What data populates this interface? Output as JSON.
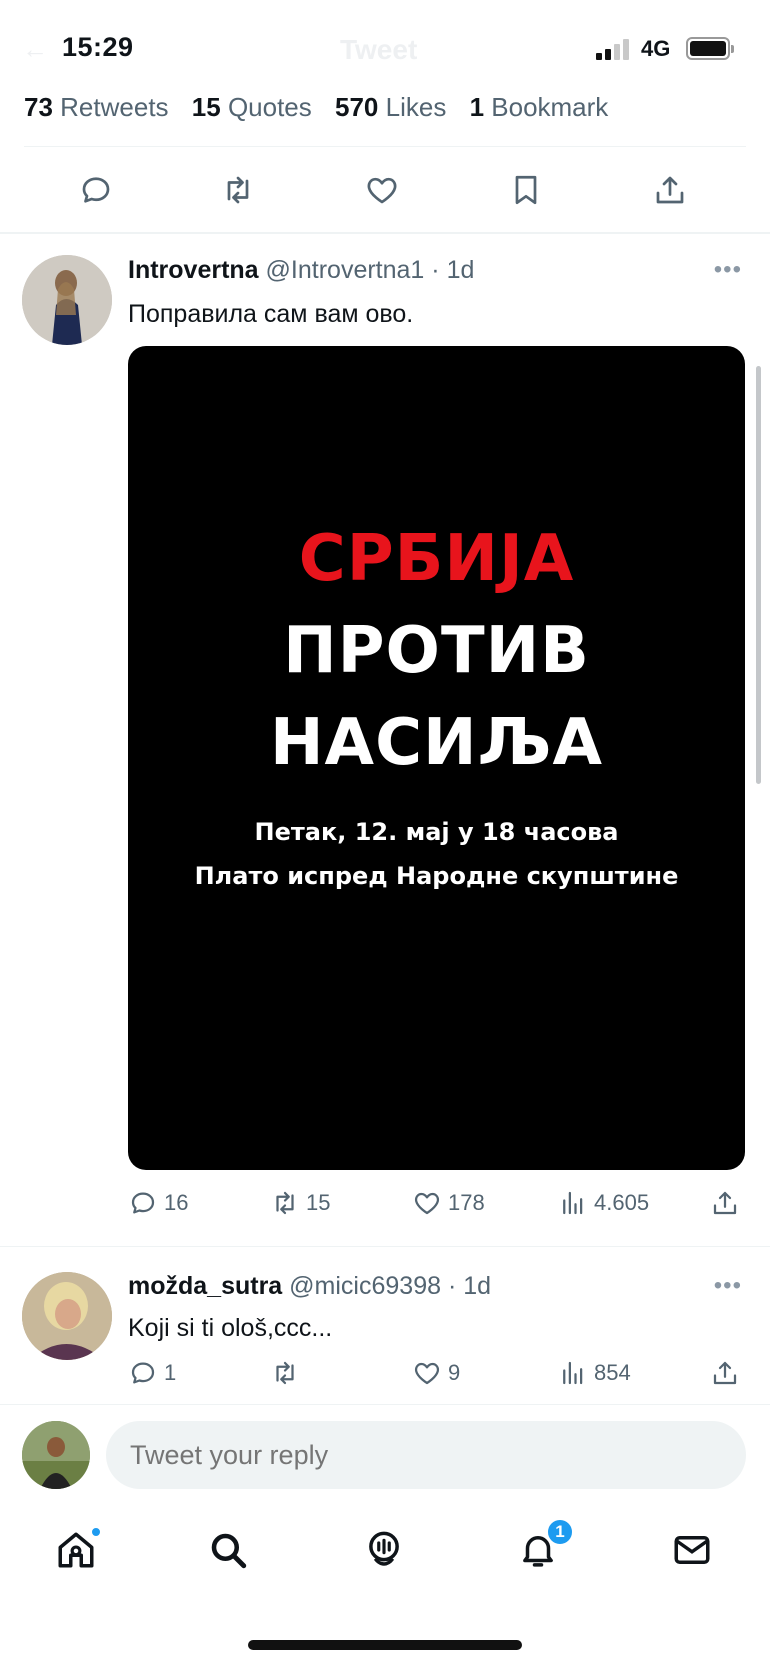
{
  "status_bar": {
    "time": "15:29",
    "network": "4G",
    "ghost_title": "Tweet"
  },
  "stats": [
    {
      "count": "73",
      "label": "Retweets"
    },
    {
      "count": "15",
      "label": "Quotes"
    },
    {
      "count": "570",
      "label": "Likes"
    },
    {
      "count": "1",
      "label": "Bookmark"
    }
  ],
  "tweets": [
    {
      "name": "Introvertna",
      "handle": "@Introvertna1",
      "time": "· 1d",
      "text": "Поправила сам вам ово.",
      "media": {
        "line1": "СРБИЈА",
        "line2": "ПРОТИВ",
        "line3": "НАСИЉА",
        "line4": "Петак, 12. мај у 18 часова",
        "line5": "Плато испред Народне скупштине"
      },
      "replies": "16",
      "retweets": "15",
      "likes": "178",
      "views": "4.605"
    },
    {
      "name": "možda_sutra",
      "handle": "@micic69398",
      "time": "· 1d",
      "text": "Koji si ti ološ,ccc...",
      "replies": "1",
      "retweets": "",
      "likes": "9",
      "views": "854"
    }
  ],
  "reply_bar": {
    "placeholder": "Tweet your reply"
  },
  "nav": {
    "notifications_badge": "1"
  },
  "colors": {
    "accent": "#1d9bf0",
    "media_red": "#e8141c",
    "secondary_text": "#536471"
  }
}
